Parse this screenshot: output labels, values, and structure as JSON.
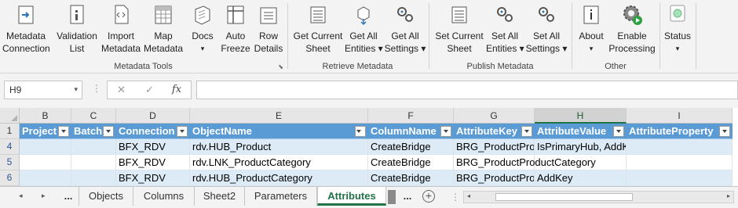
{
  "ribbon": {
    "groups": [
      {
        "label": "Metadata Tools",
        "buttons": [
          {
            "line1": "Metadata",
            "line2": "Connection",
            "icon": "connection-icon"
          },
          {
            "line1": "Validation",
            "line2": "List",
            "icon": "validation-list-icon"
          },
          {
            "line1": "Import",
            "line2": "Metadata",
            "icon": "import-icon"
          },
          {
            "line1": "Map",
            "line2": "Metadata",
            "icon": "map-grid-icon"
          },
          {
            "line1": "Docs",
            "line2": "▾",
            "icon": "docs-icon"
          },
          {
            "line1": "Auto",
            "line2": "Freeze",
            "icon": "freeze-icon"
          },
          {
            "line1": "Row",
            "line2": "Details",
            "icon": "row-details-icon"
          }
        ]
      },
      {
        "label": "Retrieve Metadata",
        "buttons": [
          {
            "line1": "Get Current",
            "line2": "Sheet",
            "icon": "sheet-icon"
          },
          {
            "line1": "Get All",
            "line2": "Entities ▾",
            "icon": "entities-icon"
          },
          {
            "line1": "Get All",
            "line2": "Settings ▾",
            "icon": "gears-icon"
          }
        ]
      },
      {
        "label": "Publish Metadata",
        "buttons": [
          {
            "line1": "Set Current",
            "line2": "Sheet",
            "icon": "sheet-icon"
          },
          {
            "line1": "Set All",
            "line2": "Entities ▾",
            "icon": "gears-icon"
          },
          {
            "line1": "Set All",
            "line2": "Settings ▾",
            "icon": "gears-icon"
          }
        ]
      },
      {
        "label": "Other",
        "buttons": [
          {
            "line1": "About",
            "line2": "▾",
            "icon": "info-icon"
          },
          {
            "line1": "Enable",
            "line2": "Processing",
            "icon": "gear-play-icon"
          }
        ]
      },
      {
        "label": "",
        "buttons": [
          {
            "line1": "Status",
            "line2": "▾",
            "icon": "status-icon"
          }
        ]
      }
    ]
  },
  "formula_bar": {
    "name_box": "H9",
    "cancel": "✕",
    "enter": "✓",
    "fx": "fx",
    "value": ""
  },
  "grid": {
    "columns": [
      "B",
      "C",
      "D",
      "E",
      "F",
      "G",
      "H",
      "I"
    ],
    "selected_column": "H",
    "header_row_number": "1",
    "headers": [
      "Project",
      "Batch",
      "Connection",
      "ObjectName",
      "ColumnName",
      "AttributeKey",
      "AttributeValue",
      "AttributeProperty"
    ],
    "rows": [
      {
        "num": "4",
        "cells": [
          "",
          "",
          "BFX_RDV",
          "rdv.HUB_Product",
          "CreateBridge",
          "BRG_ProductPro",
          "IsPrimaryHub, AddKey",
          ""
        ]
      },
      {
        "num": "5",
        "cells": [
          "",
          "",
          "BFX_RDV",
          "rdv.LNK_ProductCategory",
          "CreateBridge",
          "BRG_ProductProductCategory",
          "",
          ""
        ]
      },
      {
        "num": "6",
        "cells": [
          "",
          "",
          "BFX_RDV",
          "rdv.HUB_ProductCategory",
          "CreateBridge",
          "BRG_ProductPro",
          "AddKey",
          ""
        ]
      }
    ]
  },
  "sheet_tabs": {
    "prev": "◂",
    "next": "▸",
    "more_left": "...",
    "more_right": "...",
    "tabs": [
      "Objects",
      "Columns",
      "Sheet2",
      "Parameters",
      "Attributes"
    ],
    "active": "Attributes",
    "add": "+"
  },
  "colors": {
    "header_fill": "#5b9bd5",
    "band_fill": "#ddebf7",
    "excel_green": "#217346"
  }
}
